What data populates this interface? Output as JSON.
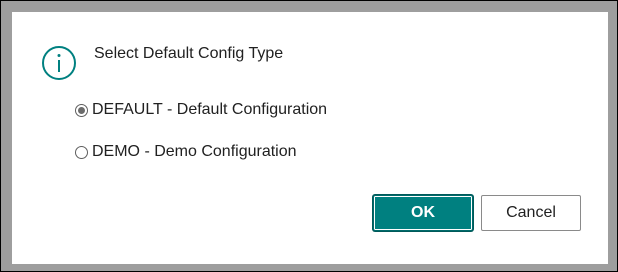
{
  "dialog": {
    "title": "Select Default Config Type",
    "icon": "info-icon",
    "accent_color": "#008080",
    "options": [
      {
        "label": "DEFAULT - Default Configuration",
        "selected": true
      },
      {
        "label": "DEMO - Demo Configuration",
        "selected": false
      }
    ],
    "buttons": {
      "ok_label": "OK",
      "cancel_label": "Cancel"
    }
  }
}
